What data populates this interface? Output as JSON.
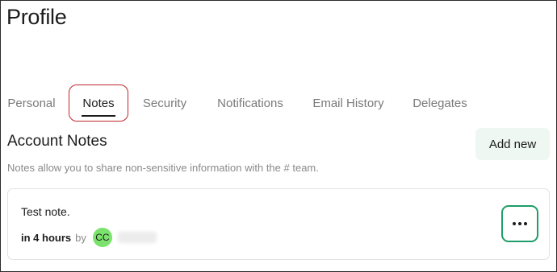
{
  "page": {
    "title": "Profile"
  },
  "tabs": [
    {
      "label": "Personal",
      "active": false
    },
    {
      "label": "Notes",
      "active": true
    },
    {
      "label": "Security",
      "active": false
    },
    {
      "label": "Notifications",
      "active": false
    },
    {
      "label": "Email History",
      "active": false
    },
    {
      "label": "Delegates",
      "active": false
    }
  ],
  "notes_section": {
    "title": "Account Notes",
    "add_button_label": "Add new",
    "description": "Notes allow you to share non-sensitive information with the # team."
  },
  "notes": [
    {
      "text": "Test note.",
      "time": "in 4 hours",
      "by_label": "by",
      "author_initials": "CC",
      "author_name": "",
      "actions_icon": "more-horizontal-icon"
    }
  ],
  "colors": {
    "active_tab_highlight": "#c0262d",
    "add_button_bg": "#eef7f2",
    "actions_button_border": "#1f9d6a",
    "avatar_bg": "#7be36d"
  }
}
